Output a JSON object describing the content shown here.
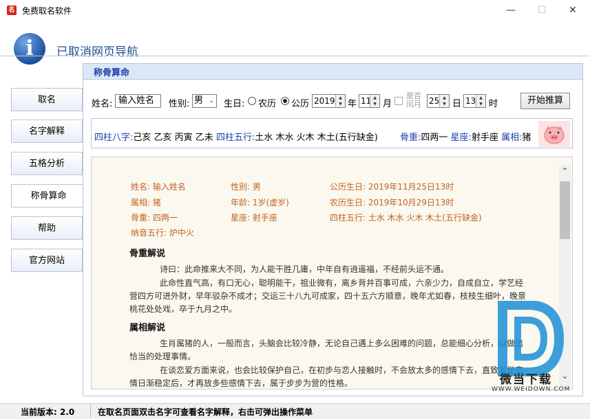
{
  "window": {
    "title": "免费取名软件",
    "minimize": "—",
    "maximize": "☐",
    "close": "✕"
  },
  "header": {
    "nav_title": "已取消网页导航"
  },
  "sidebar": {
    "items": [
      {
        "label": "取名"
      },
      {
        "label": "名字解释"
      },
      {
        "label": "五格分析"
      },
      {
        "label": "称骨算命",
        "active": true
      },
      {
        "label": "帮助"
      },
      {
        "label": "官方网站"
      }
    ]
  },
  "panel": {
    "title": "称骨算命"
  },
  "form": {
    "name_label": "姓名:",
    "name_value": "输入姓名",
    "gender_label": "性别:",
    "gender_value": "男",
    "birth_label": "生日:",
    "lunar_label": "农历",
    "solar_label": "公历",
    "year": "2019",
    "year_unit": "年",
    "month": "11",
    "month_unit": "月",
    "leap_label": "是否闰月",
    "day": "25",
    "day_unit": "日",
    "hour": "13",
    "hour_unit": "时",
    "calc_button": "开始推算"
  },
  "summary": {
    "bazi_label": "四柱八字:",
    "bazi_value": "己亥 乙亥 丙寅 乙未",
    "wuxing_label": "四柱五行:",
    "wuxing_value": "土水 木水 火木 木土(五行缺金)",
    "weight_label": "骨重:",
    "weight_value": "四两一",
    "star_label": "星座:",
    "star_value": "射手座",
    "zodiac_label": "属相:",
    "zodiac_value": "猪"
  },
  "details": {
    "name": "姓名: 输入姓名",
    "gender": "性别: 男",
    "solar_birth": "公历生日: 2019年11月25日13时",
    "zodiac": "属相: 猪",
    "age": "年龄: 1岁(虚岁)",
    "lunar_birth": "农历生日: 2019年10月29日13时",
    "weight": "骨重: 四两一",
    "star": "星座: 射手座",
    "wuxing": "四柱五行: 土水 木水 火木 木土(五行缺金)",
    "nayin": "纳音五行: 炉中火"
  },
  "sections": [
    {
      "heading": "骨重解说",
      "paras": [
        "诗曰：此命推来大不同，为人能干胜几庸，中年自有逍遥福，不经前头运不通。",
        "此命性直气高，有口无心，聪明能干，祖业微有，离乡背井百事可成，六亲少力，自成自立，学艺经营四方可进外财，早年驳杂不成才；交运三十八九可成家，四十五六方顺意，晚年尤如春，枝枝生细叶，晚景桃花处处戏，卒于九月之中。"
      ]
    },
    {
      "heading": "属相解说",
      "paras": [
        "生肖属猪的人，一般而言，头脑会比较冷静，无论自己遇上多么困难的问题，总能细心分析，以做出恰当的处理事情。",
        "在谈恋爱方面来说，也会比较保护自己，在初步与恋人接触时，不会放太多的感情下去，直致发觉恋情日渐稳定后，才再放多些感情下去，属于步步为营的性格。"
      ]
    }
  ],
  "statusbar": {
    "version": "当前版本: 2.0",
    "hint": "在取名页面双击名字可查看名字解释，右击可弹出操作菜单"
  },
  "watermark": {
    "brand": "微当下载",
    "url": "WWW.WEIDOWN.COM"
  },
  "colors": {
    "accent_blue": "#1f3fa8",
    "detail_orange": "#c0621c",
    "app_icon_red": "#d4261d"
  }
}
